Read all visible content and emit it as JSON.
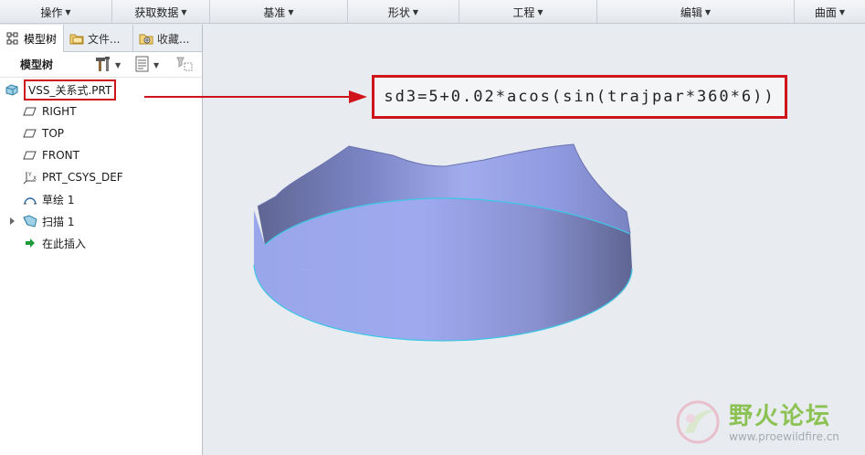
{
  "ribbon": {
    "groups": [
      {
        "label": "操作"
      },
      {
        "label": "获取数据"
      },
      {
        "label": "基准"
      },
      {
        "label": "形状"
      },
      {
        "label": "工程"
      },
      {
        "label": "编辑"
      },
      {
        "label": "曲面"
      }
    ]
  },
  "navigator": {
    "tabs": [
      {
        "label": "模型树"
      },
      {
        "label": "文件..."
      },
      {
        "label": "收藏..."
      }
    ],
    "toolbar_title": "模型树",
    "tree": {
      "part": "VSS_关系式.PRT",
      "items": [
        {
          "label": "RIGHT"
        },
        {
          "label": "TOP"
        },
        {
          "label": "FRONT"
        },
        {
          "label": "PRT_CSYS_DEF"
        },
        {
          "label": "草绘 1"
        },
        {
          "label": "扫描 1"
        },
        {
          "label": "在此插入"
        }
      ]
    }
  },
  "viewport": {
    "relation": "sd3=5+0.02*acos(sin(trajpar*360*6))"
  },
  "watermark": {
    "name": "野火论坛",
    "url": "www.proewildfire.cn"
  },
  "colors": {
    "annotation_red": "#d0141b",
    "surface_light": "#9aa6ea",
    "surface_dark": "#5f6693",
    "edge_cyan": "#40c8e8"
  }
}
